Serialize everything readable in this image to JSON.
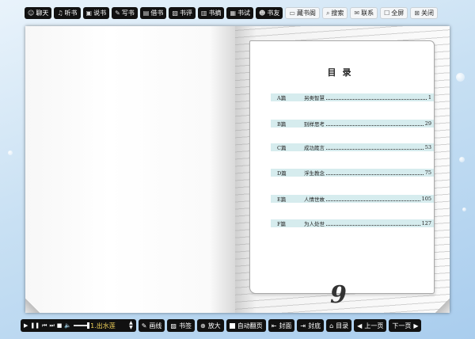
{
  "top_toolbar": {
    "chat": {
      "icon": "chat-icon",
      "label": "聊天"
    },
    "listen": {
      "icon": "listen-icon",
      "label": "听书"
    },
    "talk": {
      "icon": "talk-icon",
      "label": "说书"
    },
    "write": {
      "icon": "pen-icon",
      "label": "写书"
    },
    "borrow": {
      "icon": "book-icon",
      "label": "借书"
    },
    "review": {
      "icon": "review-icon",
      "label": "书评"
    },
    "excerpt": {
      "icon": "excerpt-icon",
      "label": "书摘"
    },
    "exam": {
      "icon": "exam-icon",
      "label": "书试"
    },
    "friends": {
      "icon": "friends-icon",
      "label": "书友"
    },
    "bookshelf": {
      "icon": "bookshelf-icon",
      "label": "藏书阁"
    },
    "search": {
      "icon": "search-icon",
      "label": "搜索"
    },
    "contact": {
      "icon": "mail-icon",
      "label": "联系"
    },
    "fullscreen": {
      "icon": "checkbox-icon",
      "label": "全屏"
    },
    "close": {
      "icon": "close-icon",
      "label": "关闭"
    }
  },
  "toc": {
    "title": "目录",
    "entries": [
      {
        "section": "A篇",
        "title": "另类智慧",
        "page": "1"
      },
      {
        "section": "B篇",
        "title": "别样思考",
        "page": "29"
      },
      {
        "section": "C篇",
        "title": "成功箴言",
        "page": "53"
      },
      {
        "section": "D篇",
        "title": "浮生教念",
        "page": "75"
      },
      {
        "section": "E篇",
        "title": "人情世故",
        "page": "105"
      },
      {
        "section": "F篇",
        "title": "为人处世",
        "page": "127"
      }
    ],
    "page_number": "9"
  },
  "bottom_toolbar": {
    "track_name": "1.出水莲",
    "volume_level": 0.9,
    "draw": {
      "icon": "draw-icon",
      "label": "画线"
    },
    "bookmark": {
      "icon": "bookmark-icon",
      "label": "书签"
    },
    "zoom": {
      "icon": "zoom-icon",
      "label": "放大"
    },
    "autoflip": {
      "icon": "checkbox-icon",
      "label": "自动翻页"
    },
    "cover": {
      "icon": "cover-icon",
      "label": "封面"
    },
    "back_cover": {
      "icon": "back-cover-icon",
      "label": "封底"
    },
    "contents": {
      "icon": "home-icon",
      "label": "目录"
    },
    "prev": {
      "icon": "prev-arrow-icon",
      "label": "上一页"
    },
    "next": {
      "icon": "next-arrow-icon",
      "label": "下一页"
    }
  }
}
